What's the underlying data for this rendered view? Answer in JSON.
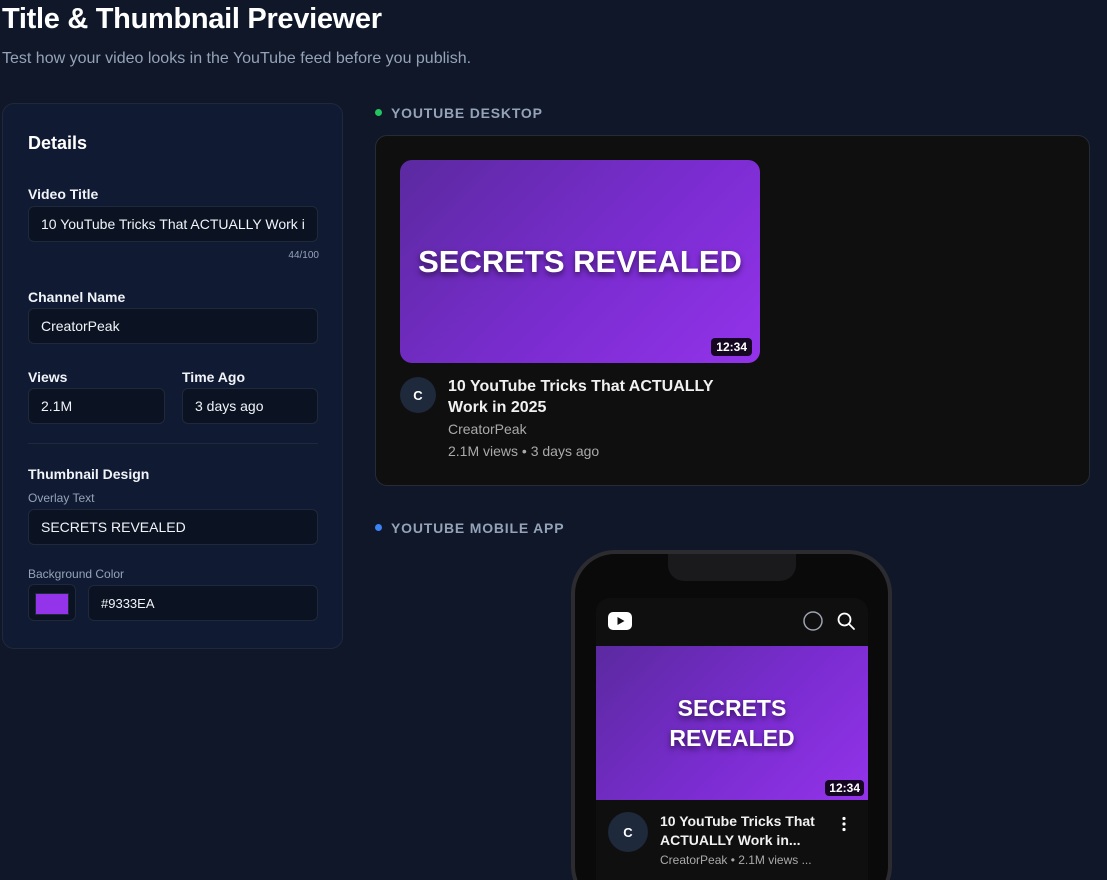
{
  "header": {
    "title": "Title & Thumbnail Previewer",
    "subtitle": "Test how your video looks in the YouTube feed before you publish."
  },
  "details": {
    "heading": "Details",
    "video_title_label": "Video Title",
    "video_title_value": "10 YouTube Tricks That ACTUALLY Work in 2025",
    "title_counter": "44/100",
    "channel_label": "Channel Name",
    "channel_value": "CreatorPeak",
    "views_label": "Views",
    "views_value": "2.1M",
    "time_label": "Time Ago",
    "time_value": "3 days ago",
    "thumb_heading": "Thumbnail Design",
    "overlay_label": "Overlay Text",
    "overlay_value": "SECRETS REVEALED",
    "bg_label": "Background Color",
    "bg_value": "#9333EA"
  },
  "desktop": {
    "heading": "YOUTUBE DESKTOP",
    "dot_color": "#22c55e",
    "thumb_text": "SECRETS REVEALED",
    "duration": "12:34",
    "avatar_letter": "C",
    "title": "10 YouTube Tricks That ACTUALLY Work in 2025",
    "channel": "CreatorPeak",
    "meta": "2.1M views • 3 days ago"
  },
  "mobile": {
    "heading": "YOUTUBE MOBILE APP",
    "dot_color": "#3b82f6",
    "thumb_text": "SECRETS REVEALED",
    "duration": "12:34",
    "avatar_letter": "C",
    "title": "10 YouTube Tricks That ACTUALLY Work in...",
    "meta": "CreatorPeak • 2.1M views ..."
  },
  "icons": {
    "youtube": "youtube-logo-icon",
    "cast": "cast-circle-icon",
    "search": "search-icon",
    "more": "more-vert-icon"
  },
  "colors": {
    "accent": "#9333ea",
    "background": "#0f1729"
  }
}
